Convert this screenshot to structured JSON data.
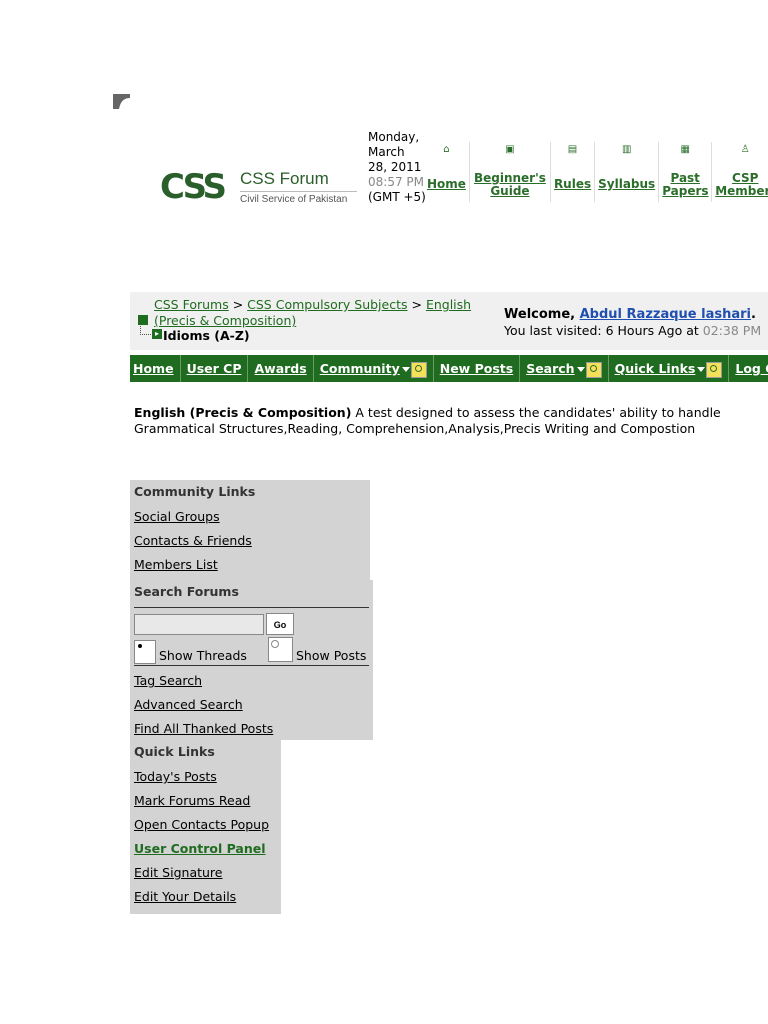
{
  "header": {
    "logo_mark": "CSS",
    "logo_name": "CSS Forum",
    "logo_sub": "Civil Service of Pakistan",
    "date_line": "Monday, March 28, 2011",
    "time": "08:57 PM",
    "timezone": "(GMT +5)"
  },
  "topnav": [
    {
      "label": "Home",
      "icon": "home-icon",
      "glyph": "⌂"
    },
    {
      "label": "Beginner's Guide",
      "icon": "book-icon",
      "glyph": "▣"
    },
    {
      "label": "Rules",
      "icon": "rules-icon",
      "glyph": "▤"
    },
    {
      "label": "Syllabus",
      "icon": "syllabus-icon",
      "glyph": "▥"
    },
    {
      "label": "Past Papers",
      "icon": "papers-icon",
      "glyph": "▦"
    },
    {
      "label": "CSP Members",
      "icon": "user-icon",
      "glyph": "♙"
    }
  ],
  "breadcrumb": {
    "root": "CSS Forums",
    "sep": " > ",
    "level1": "CSS Compulsory Subjects",
    "level2": "English (Precis & Composition)",
    "current": "Idioms (A-Z)"
  },
  "welcome": {
    "prefix": "Welcome, ",
    "user": "Abdul Razzaque lashari",
    "suffix": ".",
    "last_visit_prefix": "You last visited: 6 Hours Ago at ",
    "last_visit_time": "02:38 PM"
  },
  "navbar": {
    "home": "Home",
    "usercp": "User CP",
    "awards": "Awards",
    "community": "Community",
    "newposts": "New Posts",
    "search": "Search",
    "quicklinks": "Quick Links",
    "logout": "Log Out"
  },
  "forum": {
    "name": "English (Precis & Composition)",
    "description": "A test designed to assess the candidates' ability to handle Grammatical Structures,Reading, Comprehension,Analysis,Precis Writing and Compostion"
  },
  "community_links": {
    "heading": "Community Links",
    "items": [
      "Social Groups",
      "Contacts & Friends",
      "Members List"
    ]
  },
  "search_forums": {
    "heading": "Search Forums",
    "input_value": "",
    "go_label": "Go",
    "show_threads": "Show Threads",
    "show_posts": "Show Posts",
    "items": [
      "Tag Search",
      "Advanced Search",
      "Find All Thanked Posts"
    ]
  },
  "quick_links": {
    "heading": "Quick Links",
    "items": [
      "Today's Posts",
      "Mark Forums Read",
      "Open Contacts Popup",
      "User Control Panel",
      "Edit Signature",
      "Edit Your Details"
    ]
  },
  "colors": {
    "brand_green": "#1f6b1f",
    "link_blue": "#1f4faf",
    "panel_gray": "#d3d3d3"
  }
}
